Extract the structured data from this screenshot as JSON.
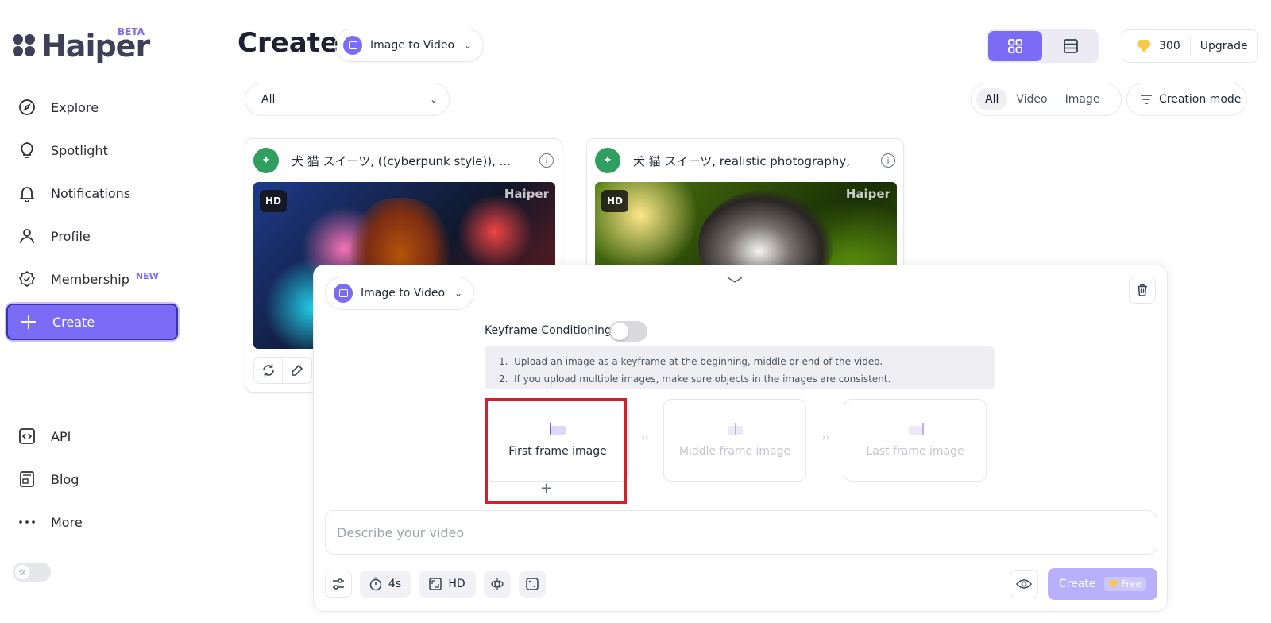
{
  "brand": {
    "name": "Haiper",
    "badge": "BETA"
  },
  "sidebar": {
    "items": [
      {
        "label": "Explore",
        "icon": "compass-icon"
      },
      {
        "label": "Spotlight",
        "icon": "lightbulb-icon"
      },
      {
        "label": "Notifications",
        "icon": "bell-icon"
      },
      {
        "label": "Profile",
        "icon": "user-icon"
      },
      {
        "label": "Membership",
        "icon": "badge-check-icon",
        "badge": "NEW"
      },
      {
        "label": "Create",
        "icon": "plus-icon",
        "active": true
      }
    ],
    "bottom_items": [
      {
        "label": "API",
        "icon": "code-icon"
      },
      {
        "label": "Blog",
        "icon": "newspaper-icon"
      },
      {
        "label": "More",
        "icon": "more-dots-icon"
      }
    ],
    "theme_toggle_icon": "sun-icon"
  },
  "header": {
    "title": "Create",
    "mode_select": "Image to Video",
    "credits": "300",
    "upgrade_label": "Upgrade"
  },
  "filters": {
    "category": "All",
    "type_tabs": [
      "All",
      "Video",
      "Image"
    ],
    "selected_type": "All",
    "creation_mode_label": "Creation mode"
  },
  "cards": [
    {
      "title": "犬 猫 スイーツ, ((cyberpunk style)), ...",
      "badge": "HD",
      "watermark": "Haiper"
    },
    {
      "title": "犬 猫 スイーツ, realistic photography,",
      "badge": "HD",
      "watermark": "Haiper"
    }
  ],
  "panel": {
    "mode_select": "Image to Video",
    "keyframe_label": "Keyframe Conditioning",
    "keyframe_enabled": false,
    "hints": [
      "Upload an image as a keyframe at the beginning, middle or end of the video.",
      "If you upload multiple images, make sure objects in the images are consistent."
    ],
    "frames": [
      "First frame image",
      "Middle frame image",
      "Last frame image"
    ],
    "arrow_glyph": "››",
    "add_glyph": "+",
    "prompt_placeholder": "Describe your video",
    "tools": {
      "duration": "4s",
      "quality": "HD"
    },
    "create_label": "Create",
    "free_label": "Free"
  },
  "colors": {
    "accent": "#7b6cf6",
    "highlight": "#d21f2b",
    "green": "#2f9e5f"
  }
}
